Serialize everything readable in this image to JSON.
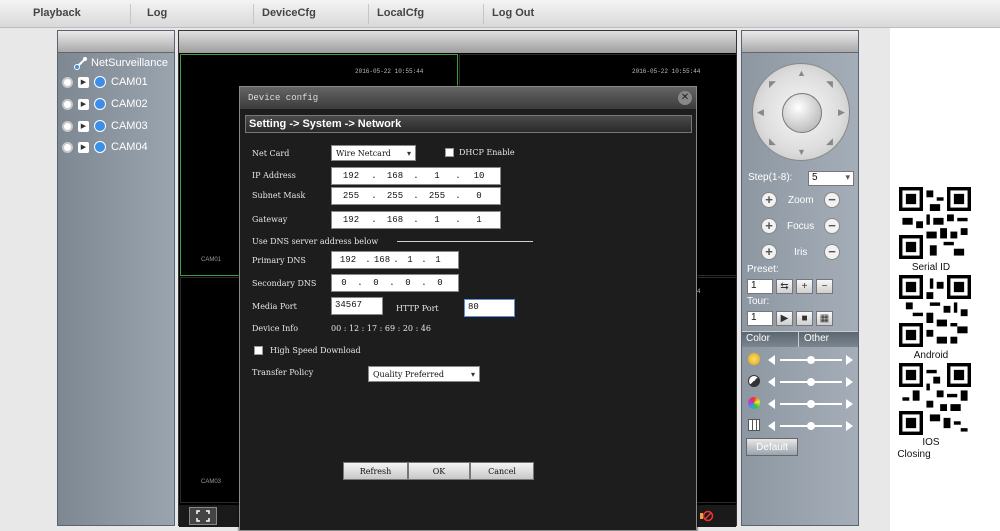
{
  "nav": {
    "tabs": [
      "Playback",
      "Log",
      "DeviceCfg",
      "LocalCfg",
      "Log Out"
    ]
  },
  "sidebar": {
    "root": "NetSurveillance",
    "cameras": [
      "CAM01",
      "CAM02",
      "CAM03",
      "CAM04"
    ]
  },
  "video": {
    "timestamp_1": "2016-05-22 10:55:44",
    "timestamp_2": "2016-05-22 10:55:44",
    "cell_label_1": "CAM01",
    "cell_label_2": "CAM03",
    "side_marker": "4"
  },
  "dialog": {
    "title": "Device config",
    "breadcrumb": "Setting -> System -> Network",
    "net_card_label": "Net Card",
    "net_card_value": "Wire Netcard",
    "dhcp_label": "DHCP Enable",
    "ip_label": "IP Address",
    "ip": [
      "192",
      "168",
      "1",
      "10"
    ],
    "mask_label": "Subnet Mask",
    "mask": [
      "255",
      "255",
      "255",
      "0"
    ],
    "gateway_label": "Gateway",
    "gateway": [
      "192",
      "168",
      "1",
      "1"
    ],
    "dns_section": "Use DNS server address below",
    "primary_dns_label": "Primary DNS",
    "primary_dns": [
      "192",
      "168",
      "1",
      "1"
    ],
    "secondary_dns_label": "Secondary DNS",
    "secondary_dns": [
      "0",
      "0",
      "0",
      "0"
    ],
    "media_port_label": "Media Port",
    "media_port": "34567",
    "http_port_label": "HTTP Port",
    "http_port": "80",
    "device_info_label": "Device Info",
    "device_info": "00 : 12 : 17 : 69 : 20 : 46",
    "high_speed_label": "High Speed Download",
    "transfer_label": "Transfer Policy",
    "transfer_value": "Quality Preferred",
    "refresh": "Refresh",
    "ok": "OK",
    "cancel": "Cancel"
  },
  "ptz": {
    "step_label": "Step(1-8):",
    "step_value": "5",
    "zoom": "Zoom",
    "focus": "Focus",
    "iris": "Iris",
    "preset_label": "Preset:",
    "preset_value": "1",
    "tour_label": "Tour:",
    "tour_value": "1",
    "color_tab": "Color",
    "other_tab": "Other",
    "default_btn": "Default"
  },
  "qr": {
    "serial": "Serial ID",
    "android": "Android",
    "ios": "IOS",
    "closing": "Closing"
  },
  "sliders": [
    0.5,
    0.5,
    0.5,
    0.5
  ]
}
